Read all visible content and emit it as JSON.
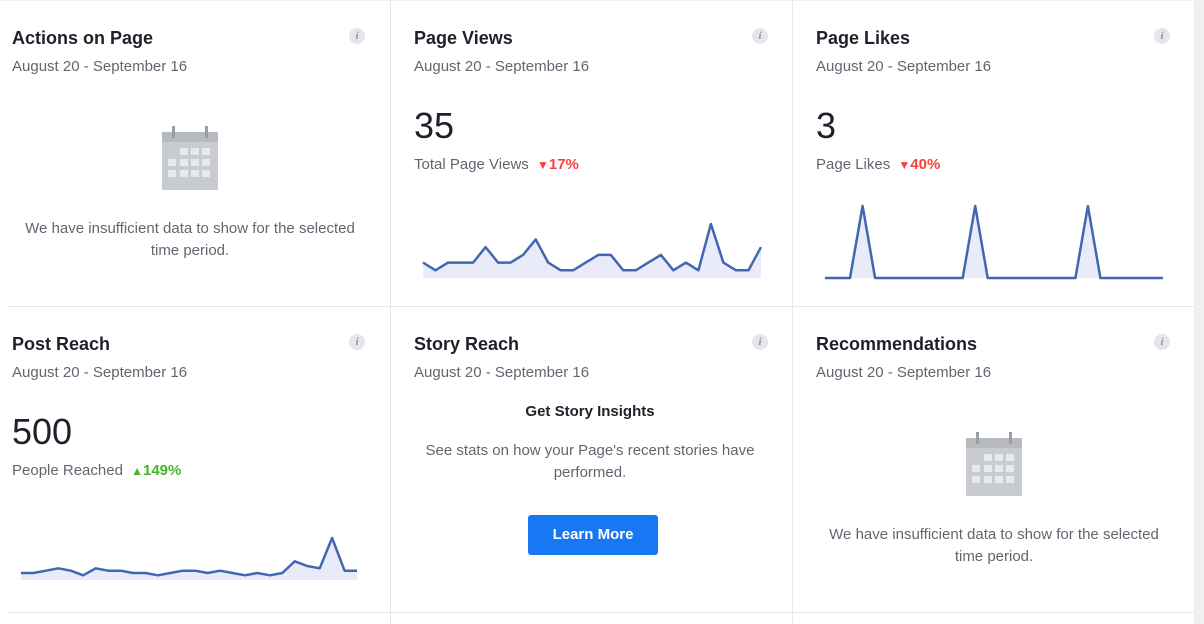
{
  "cards": [
    {
      "title": "Actions on Page",
      "date": "August 20 - September 16",
      "message": "We have insufficient data to show for the selected time period."
    },
    {
      "title": "Page Views",
      "date": "August 20 - September 16",
      "value": "35",
      "metric_label": "Total Page Views",
      "change": "17%",
      "change_direction": "down",
      "spark": [
        2,
        1,
        2,
        2,
        2,
        4,
        2,
        2,
        3,
        5,
        2,
        1,
        1,
        2,
        3,
        3,
        1,
        1,
        2,
        3,
        1,
        2,
        1,
        7,
        2,
        1,
        1,
        4
      ]
    },
    {
      "title": "Page Likes",
      "date": "August 20 - September 16",
      "value": "3",
      "metric_label": "Page Likes",
      "change": "40%",
      "change_direction": "down",
      "spark": [
        0,
        0,
        0,
        1,
        0,
        0,
        0,
        0,
        0,
        0,
        0,
        0,
        1,
        0,
        0,
        0,
        0,
        0,
        0,
        0,
        0,
        1,
        0,
        0,
        0,
        0,
        0,
        0
      ]
    },
    {
      "title": "Post Reach",
      "date": "August 20 - September 16",
      "value": "500",
      "metric_label": "People Reached",
      "change": "149%",
      "change_direction": "up",
      "spark": [
        3,
        3,
        4,
        5,
        4,
        2,
        5,
        4,
        4,
        3,
        3,
        2,
        3,
        4,
        4,
        3,
        4,
        3,
        2,
        3,
        2,
        3,
        8,
        6,
        5,
        18,
        4,
        4
      ]
    },
    {
      "title": "Story Reach",
      "date": "August 20 - September 16",
      "promo_heading": "Get Story Insights",
      "promo_text": "See stats on how your Page's recent stories have performed.",
      "button_label": "Learn More"
    },
    {
      "title": "Recommendations",
      "date": "August 20 - September 16",
      "message": "We have insufficient data to show for the selected time period."
    }
  ],
  "icons": {
    "info": "info-icon",
    "calendar": "calendar-icon"
  },
  "colors": {
    "line": "#4267b2",
    "fill": "#e9ecf8",
    "down": "#fa3e3e",
    "up": "#42b72a",
    "button": "#1877f2"
  }
}
